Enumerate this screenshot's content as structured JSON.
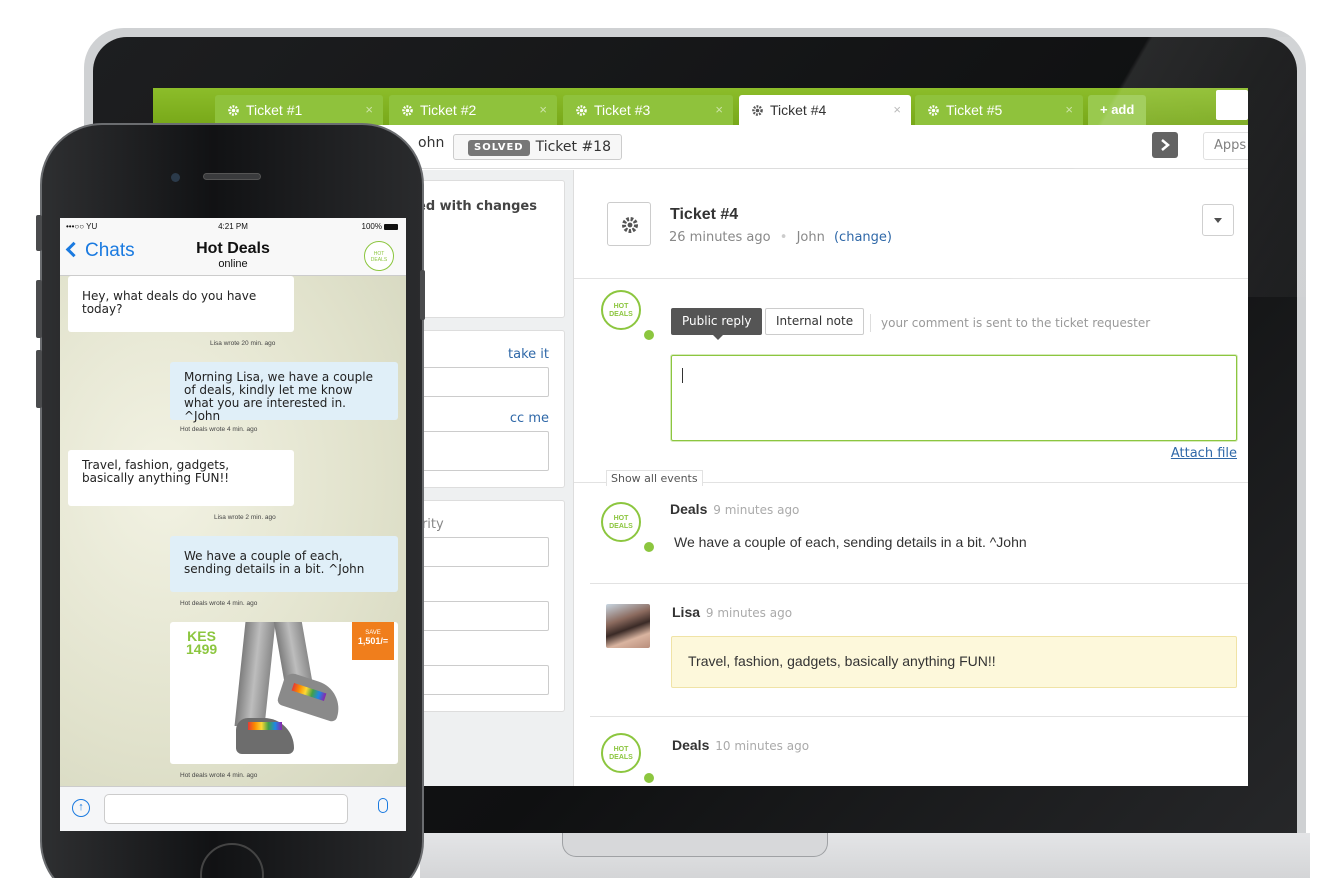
{
  "tabs": [
    {
      "label": "Ticket #1",
      "close": "×"
    },
    {
      "label": "Ticket #2",
      "close": "×"
    },
    {
      "label": "Ticket #3",
      "close": "×"
    },
    {
      "label": "Ticket #4",
      "close": "×",
      "active": true
    },
    {
      "label": "Ticket #5",
      "close": "×"
    }
  ],
  "add_tab": "+ add",
  "toolbar": {
    "crumb_user": "ohn",
    "status_badge": "SOLVED",
    "crumb_ticket": "Ticket #18",
    "next_icon": "chevron-right-icon",
    "apps": "Apps"
  },
  "left_panel": {
    "notice": "ed with changes",
    "take_it": "take it",
    "cc_me": "cc me",
    "field_partial": "o",
    "priority_label": "ority"
  },
  "ticket": {
    "title": "Ticket #4",
    "age": "26 minutes ago",
    "dot": "•",
    "requester": "John",
    "change": "(change)"
  },
  "composer": {
    "public_reply": "Public reply",
    "internal_note": "Internal note",
    "hint": "your comment is sent to the ticket requester",
    "attach": "Attach file",
    "show_events": "Show all events"
  },
  "events": [
    {
      "author": "Deals",
      "time": "9 minutes ago",
      "body": "We have a couple of each, sending details in a bit. ^John"
    },
    {
      "author": "Lisa",
      "time": "9 minutes ago",
      "body": "Travel, fashion, gadgets, basically anything FUN!!"
    },
    {
      "author": "Deals",
      "time": "10 minutes ago",
      "body": ""
    }
  ],
  "avatar_text": "HOT DEALS",
  "phone": {
    "status": {
      "carrier": "•••○○ YU",
      "time": "4:21 PM",
      "battery": "100%"
    },
    "nav": {
      "back": "Chats",
      "title": "Hot Deals",
      "subtitle": "online"
    },
    "messages": [
      {
        "text": "Hey, what deals do you have today?",
        "meta": "Lisa wrote 20 min. ago"
      },
      {
        "text": "Morning Lisa, we have a couple of deals, kindly let me know what you are interested in. ^John",
        "meta": "Hot deals wrote 4 min. ago"
      },
      {
        "text": "Travel, fashion, gadgets, basically anything FUN!!",
        "meta": "Lisa wrote 2 min. ago"
      },
      {
        "text": "We have a couple of each, sending details in a bit. ^John",
        "meta": "Hot deals wrote 4 min. ago"
      }
    ],
    "deal": {
      "currency": "KES",
      "price": "1499",
      "save_label": "SAVE",
      "save_value": "1,501/=",
      "meta": "Hot deals wrote 4 min. ago"
    }
  },
  "colors": {
    "brand_green": "#8cc63f",
    "tab_bar": "#78a819",
    "link_blue": "#2f68a8",
    "ios_blue": "#1a7ae0",
    "accent_orange": "#f07e1c"
  }
}
